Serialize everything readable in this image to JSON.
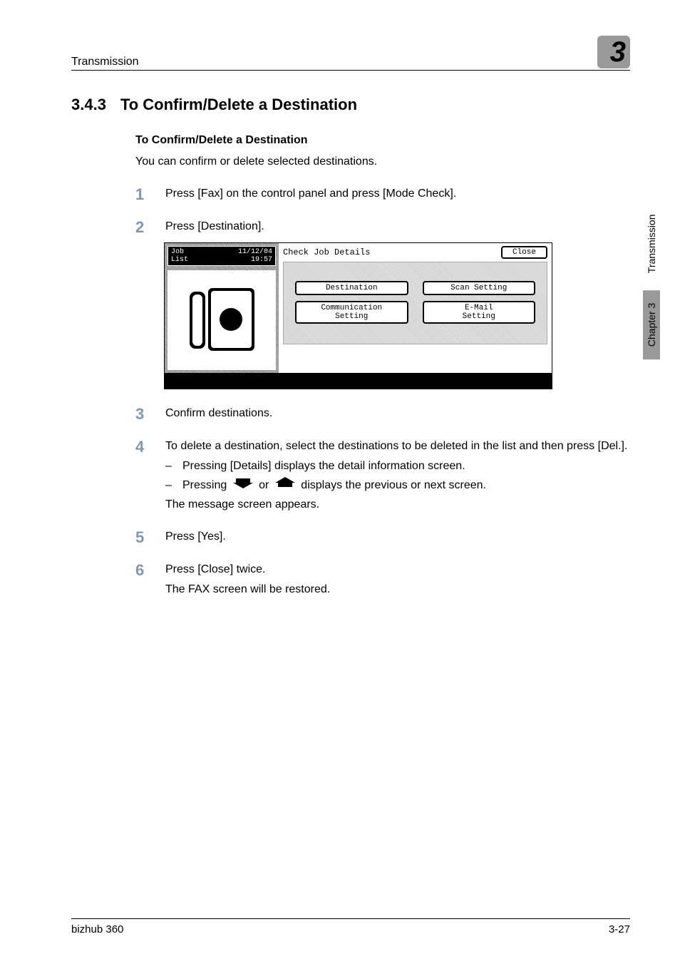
{
  "header": {
    "section": "Transmission",
    "chapterNumber": "3"
  },
  "heading": {
    "number": "3.4.3",
    "title": "To Confirm/Delete a Destination"
  },
  "subheading": "To Confirm/Delete a Destination",
  "intro": "You can confirm or delete selected destinations.",
  "steps": {
    "s1": {
      "num": "1",
      "text": "Press [Fax] on the control panel and press [Mode Check]."
    },
    "s2": {
      "num": "2",
      "text": "Press [Destination]."
    },
    "s3": {
      "num": "3",
      "text": "Confirm destinations."
    },
    "s4": {
      "num": "4",
      "text": "To delete a destination, select the destinations to be deleted in the list and then press [Del.].",
      "sub1": "Pressing [Details] displays the detail information screen.",
      "sub2a": "Pressing",
      "sub2b": "or",
      "sub2c": "displays the previous or next screen.",
      "follow": "The message screen appears."
    },
    "s5": {
      "num": "5",
      "text": "Press [Yes]."
    },
    "s6": {
      "num": "6",
      "text": "Press [Close] twice.",
      "follow": "The FAX screen will be restored."
    }
  },
  "lcd": {
    "tabLeft": "Job\nList",
    "tabRight": "11/12/04\n19:57",
    "title": "Check Job Details",
    "close": "Close",
    "btnDestination": "Destination",
    "btnScan": "Scan Setting",
    "btnComm": "Communication\nSetting",
    "btnEmail": "E-Mail\nSetting"
  },
  "sideTab": {
    "chapter": "Chapter 3",
    "section": "Transmission"
  },
  "footer": {
    "left": "bizhub 360",
    "right": "3-27"
  }
}
